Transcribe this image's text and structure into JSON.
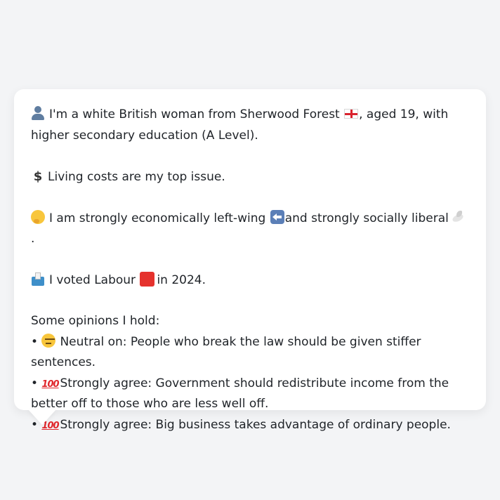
{
  "profile": {
    "identity": {
      "icon": "person-icon",
      "text_before_flag": "I'm a white British woman from Sherwood Forest",
      "flag_icon": "england-flag-icon",
      "text_after_flag": ", aged 19, with higher secondary education (A Level)."
    },
    "issue": {
      "icon": "dollar-icon",
      "icon_glyph": "$",
      "text": "Living costs are my top issue."
    },
    "ideology": {
      "icon": "thinking-face-icon",
      "text_before_arrow": "I am strongly economically left-wing",
      "arrow_icon": "left-arrow-icon",
      "text_middle": "and strongly socially liberal",
      "dove_icon": "dove-icon",
      "text_end": "."
    },
    "vote": {
      "icon": "ballot-box-icon",
      "text_before": "I voted Labour",
      "party_icon": "red-square-icon",
      "party_color": "#e5322d",
      "text_after": "in 2024."
    },
    "opinions_heading": "Some opinions I hold:",
    "opinions": [
      {
        "bullet": "•",
        "icon": "neutral-face-icon",
        "stance": "Neutral on:",
        "statement": "People who break the law should be given stiffer sentences."
      },
      {
        "bullet": "•",
        "icon": "hundred-points-icon",
        "icon_glyph": "100",
        "stance": "Strongly agree:",
        "statement": "Government should redistribute income from the better off to those who are less well off."
      },
      {
        "bullet": "•",
        "icon": "hundred-points-icon",
        "icon_glyph": "100",
        "stance": "Strongly agree:",
        "statement": "Big business takes advantage of ordinary people."
      }
    ]
  },
  "colors": {
    "page_background": "#f3f4f6",
    "bubble_background": "#ffffff",
    "text": "#1f2328"
  }
}
